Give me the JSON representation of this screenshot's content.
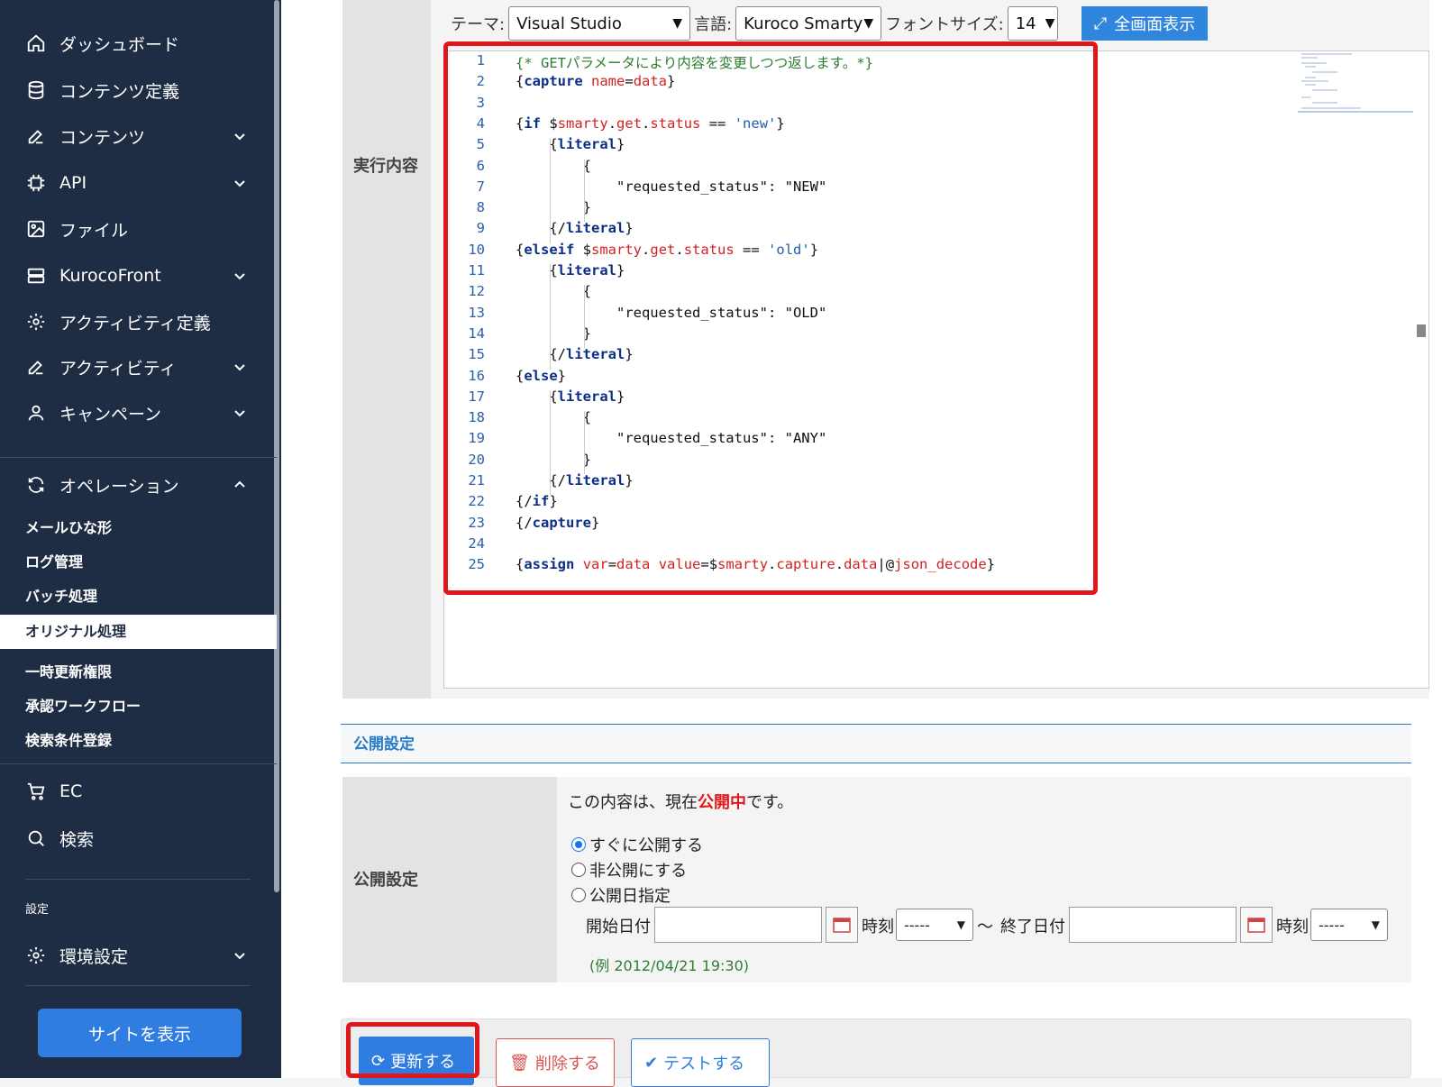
{
  "sidebar": {
    "items": [
      {
        "label": "ダッシュボード",
        "icon": "home-icon"
      },
      {
        "label": "コンテンツ定義",
        "icon": "database-icon"
      },
      {
        "label": "コンテンツ",
        "icon": "edit-icon"
      },
      {
        "label": "API",
        "icon": "chip-icon"
      },
      {
        "label": "ファイル",
        "icon": "image-icon"
      },
      {
        "label": "KurocoFront",
        "icon": "server-icon"
      },
      {
        "label": "アクティビティ定義",
        "icon": "gear-icon"
      },
      {
        "label": "アクティビティ",
        "icon": "edit-icon"
      },
      {
        "label": "キャンペーン",
        "icon": "user-icon"
      },
      {
        "label": "オペレーション",
        "icon": "refresh-icon"
      }
    ],
    "operation_subitems": [
      "メールひな形",
      "ログ管理",
      "バッチ処理",
      "オリジナル処理",
      "一時更新権限",
      "承認ワークフロー",
      "検索条件登録"
    ],
    "extra_items": [
      {
        "label": "EC",
        "icon": "cart-icon"
      },
      {
        "label": "検索",
        "icon": "search-icon"
      }
    ],
    "settings_heading": "設定",
    "settings_item": "環境設定",
    "site_button": "サイトを表示"
  },
  "editor": {
    "row_label": "実行内容",
    "theme_label": "テーマ:",
    "theme_value": "Visual Studio",
    "lang_label": "言語:",
    "lang_value": "Kuroco Smarty",
    "fontsize_label": "フォントサイズ:",
    "fontsize_value": "14",
    "fullscreen_button": "全画面表示",
    "lines": [
      "{* GETパラメータにより内容を変更しつつ返します。*}",
      "{capture name=data}",
      "",
      "{if $smarty.get.status == 'new'}",
      "    {literal}",
      "        {",
      "            \"requested_status\": \"NEW\"",
      "        }",
      "    {/literal}",
      "{elseif $smarty.get.status == 'old'}",
      "    {literal}",
      "        {",
      "            \"requested_status\": \"OLD\"",
      "        }",
      "    {/literal}",
      "{else}",
      "    {literal}",
      "        {",
      "            \"requested_status\": \"ANY\"",
      "        }",
      "    {/literal}",
      "{/if}",
      "{/capture}",
      "",
      "{assign var=data value=$smarty.capture.data|@json_decode}"
    ]
  },
  "publish": {
    "section_title": "公開設定",
    "row_label": "公開設定",
    "status_prefix": "この内容は、現在",
    "status_value": "公開中",
    "status_suffix": "です。",
    "options": [
      "すぐに公開する",
      "非公開にする",
      "公開日指定"
    ],
    "selected_option": "すぐに公開する",
    "start_label": "開始日付",
    "time_label": "時刻",
    "time_value": "-----",
    "tilde": "〜",
    "end_label": "終了日付",
    "example": "(例 2012/04/21 19:30)"
  },
  "actions": {
    "update": "更新する",
    "delete": "削除する",
    "test": "テストする"
  },
  "colors": {
    "sidebar_bg": "#1f2d44",
    "accent": "#2f7de1",
    "highlight_red": "#e0161b"
  }
}
